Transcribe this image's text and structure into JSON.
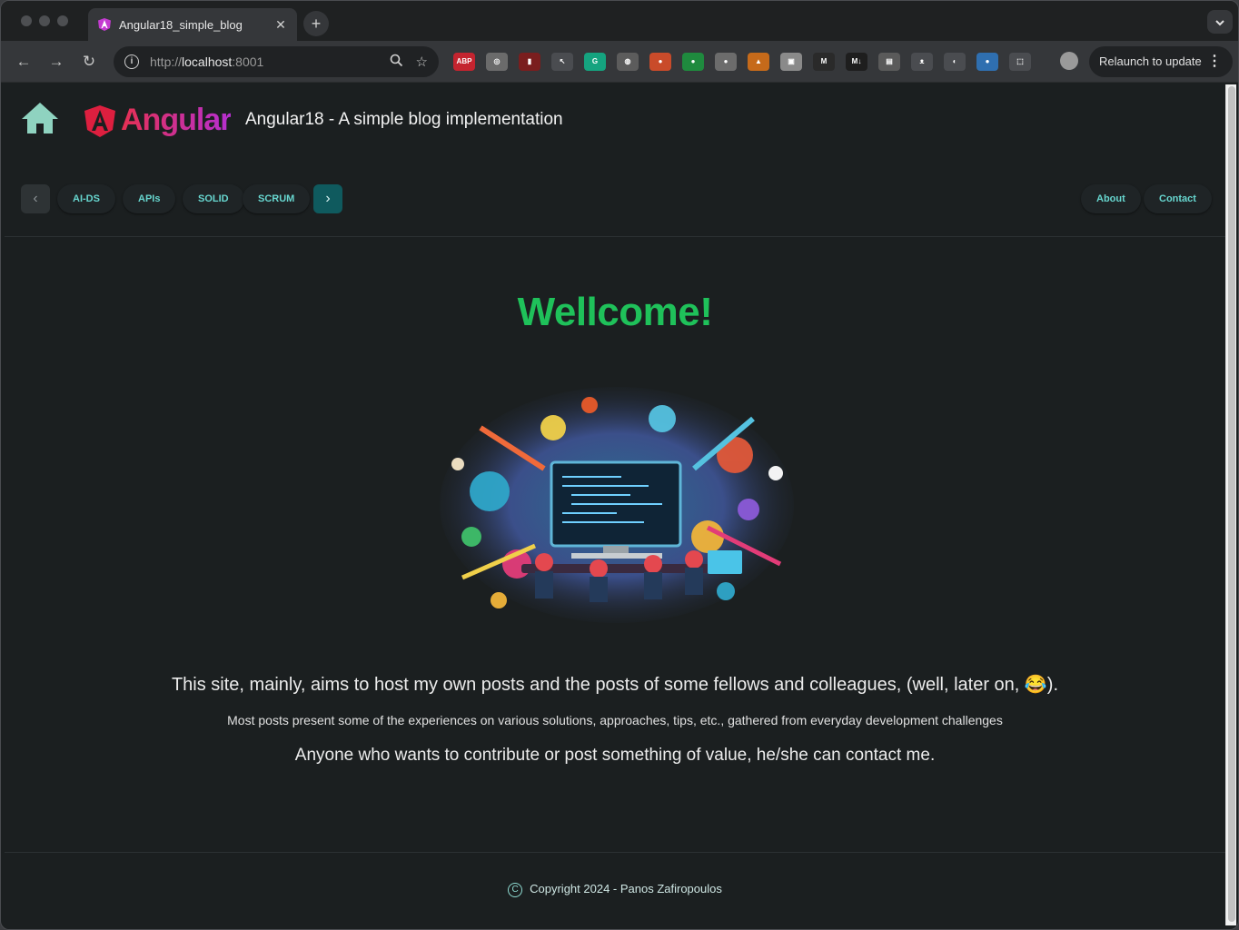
{
  "browser": {
    "tab_title": "Angular18_simple_blog",
    "url_scheme": "http://",
    "url_host": "localhost",
    "url_port": ":8001",
    "relaunch_label": "Relaunch to update",
    "new_tab_symbol": "+",
    "tab_close_symbol": "✕",
    "extensions": [
      {
        "name": "adblock-icon",
        "label": "ABP",
        "color": "#c4242f"
      },
      {
        "name": "ring-extension-icon",
        "label": "◎",
        "color": "#6b6b6b"
      },
      {
        "name": "pdf-extension-icon",
        "label": "▮",
        "color": "#7a1e1e"
      },
      {
        "name": "cursor-extension-icon",
        "label": "↖",
        "color": "#4a4c50"
      },
      {
        "name": "grammarly-icon",
        "label": "G",
        "color": "#15a37f"
      },
      {
        "name": "circle-extension-icon",
        "label": "◍",
        "color": "#5c5c5c"
      },
      {
        "name": "color-wheel-icon",
        "label": "●",
        "color": "#c94b2a"
      },
      {
        "name": "green-extension-icon",
        "label": "●",
        "color": "#1f8a3e"
      },
      {
        "name": "owl-extension-icon",
        "label": "●",
        "color": "#6c6c6c"
      },
      {
        "name": "flame-extension-icon",
        "label": "▲",
        "color": "#c66a1a"
      },
      {
        "name": "image-extension-icon",
        "label": "▣",
        "color": "#8a8a8a"
      },
      {
        "name": "medium-extension-icon",
        "label": "M",
        "color": "#2a2a2a"
      },
      {
        "name": "markdown-extension-icon",
        "label": "M↓",
        "color": "#1e1e1e"
      },
      {
        "name": "window-extension-icon",
        "label": "▤",
        "color": "#5a5a5a"
      },
      {
        "name": "cat-extension-icon",
        "label": "ᴥ",
        "color": "#4a4c50"
      },
      {
        "name": "moon-extension-icon",
        "label": "◐",
        "color": "#4a4c50"
      },
      {
        "name": "blue-extension-icon",
        "label": "●",
        "color": "#2f6fb0"
      },
      {
        "name": "puzzle-icon",
        "label": "⬚",
        "color": "#4a4c50"
      }
    ]
  },
  "site": {
    "title": "Angular18 - A simple blog implementation",
    "logo_text": "Angular",
    "nav_items": [
      "AI-DS",
      "APIs",
      "SOLID",
      "SCRUM"
    ],
    "right_nav": [
      "About",
      "Contact"
    ],
    "welcome": "Wellcome!",
    "intro_line": "This site, mainly, aims to host my own posts and the posts of some fellows and colleagues, (well, later on, 😂).",
    "detail_line": "Most posts present some of the experiences on various solutions, approaches, tips, etc., gathered from everyday development challenges",
    "contact_line": "Anyone who wants to contribute or post something of value, he/she can contact me.",
    "footer": "Copyright 2024 - Panos Zafiropoulos",
    "accent_color": "#1fc15a",
    "link_color": "#67d6cf"
  }
}
